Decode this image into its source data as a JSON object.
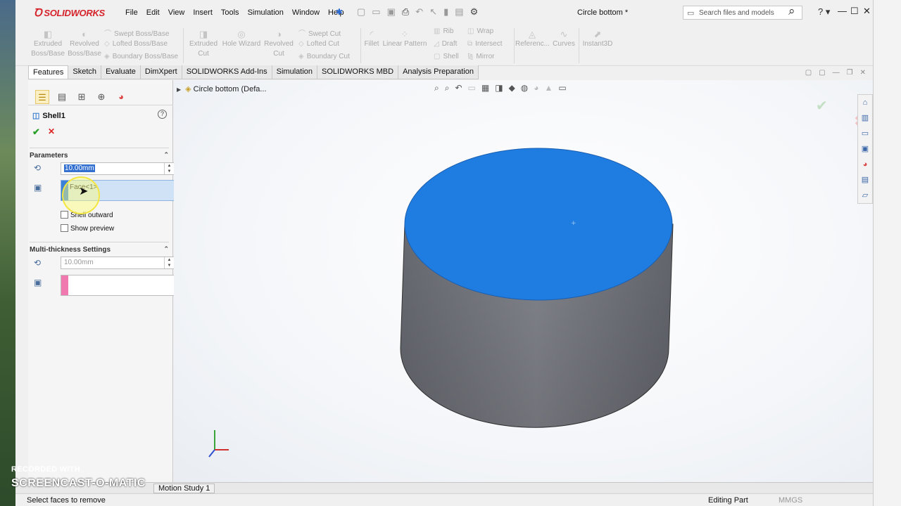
{
  "app": {
    "logo": "SOLIDWORKS",
    "document_title": "Circle bottom *"
  },
  "menu": [
    "File",
    "Edit",
    "View",
    "Insert",
    "Tools",
    "Simulation",
    "Window",
    "Help"
  ],
  "search": {
    "placeholder": "Search files and models"
  },
  "commands": {
    "extruded_boss": "Extruded Boss/Base",
    "revolved_boss": "Revolved Boss/Base",
    "swept_boss": "Swept Boss/Base",
    "lofted_boss": "Lofted Boss/Base",
    "boundary_boss": "Boundary Boss/Base",
    "extruded_cut": "Extruded Cut",
    "hole_wizard": "Hole Wizard",
    "revolved_cut": "Revolved Cut",
    "swept_cut": "Swept Cut",
    "lofted_cut": "Lofted Cut",
    "boundary_cut": "Boundary Cut",
    "fillet": "Fillet",
    "linear_pattern": "Linear Pattern",
    "rib": "Rib",
    "draft": "Draft",
    "shell": "Shell",
    "wrap": "Wrap",
    "intersect": "Intersect",
    "mirror": "Mirror",
    "reference": "Referenc...",
    "curves": "Curves",
    "instant3d": "Instant3D"
  },
  "tabs": [
    "Features",
    "Sketch",
    "Evaluate",
    "DimXpert",
    "SOLIDWORKS Add-Ins",
    "Simulation",
    "SOLIDWORKS MBD",
    "Analysis Preparation"
  ],
  "property_manager": {
    "title": "Shell1",
    "help": "?",
    "parameters": {
      "header": "Parameters",
      "thickness": "10.00mm",
      "faces_item": "Face<1>",
      "shell_outward": "Shell outward",
      "show_preview": "Show preview"
    },
    "multi_thickness": {
      "header": "Multi-thickness Settings",
      "thickness": "10.00mm"
    }
  },
  "graphics": {
    "tree_root": "Circle bottom  (Defa..."
  },
  "bottom_tabs": {
    "motion": "Motion Study 1"
  },
  "status": {
    "message": "Select faces to remove",
    "mode": "Editing Part",
    "units": "MMGS"
  },
  "watermark": {
    "line1": "RECORDED WITH",
    "line2": "SCREENCAST-O-MATIC"
  },
  "colors": {
    "accent": "#d5232b",
    "selected_face": "#1f7ce0",
    "body": "#7a7c84"
  }
}
